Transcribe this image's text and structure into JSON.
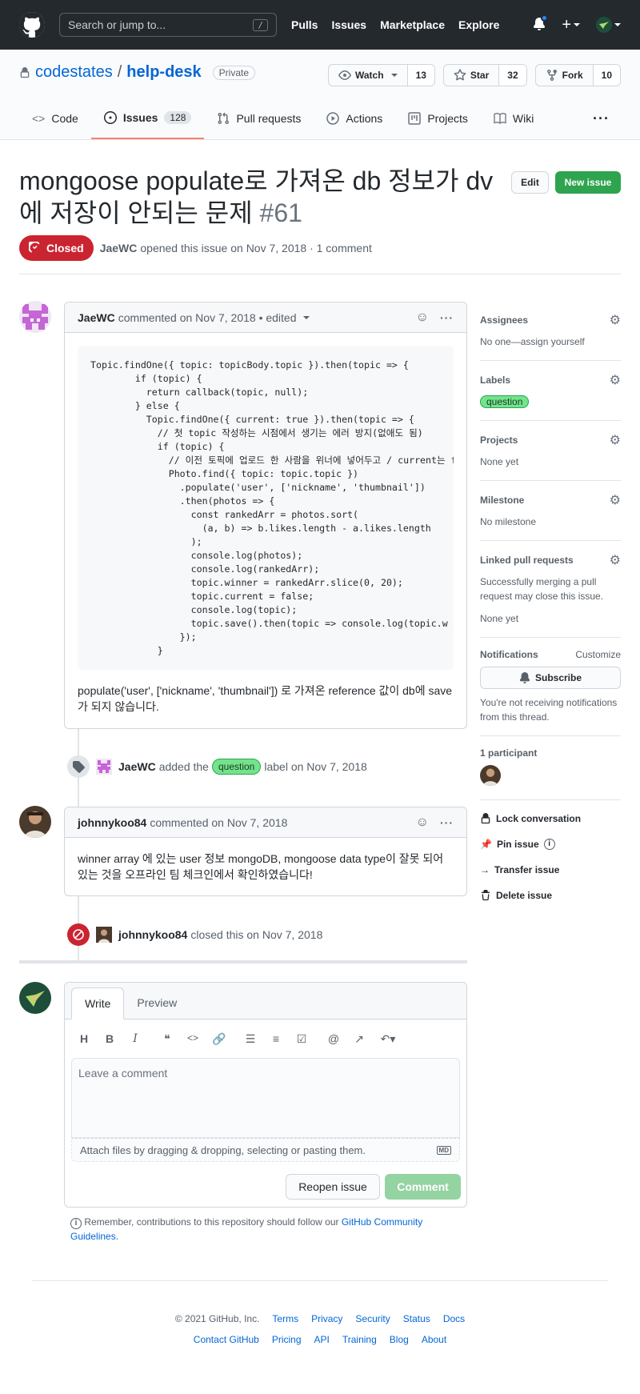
{
  "header": {
    "search_placeholder": "Search or jump to...",
    "search_shortcut": "/",
    "nav": [
      "Pulls",
      "Issues",
      "Marketplace",
      "Explore"
    ]
  },
  "repo": {
    "owner": "codestates",
    "separator": "/",
    "name": "help-desk",
    "visibility": "Private",
    "watch_label": "Watch",
    "watch_count": "13",
    "star_label": "Star",
    "star_count": "32",
    "fork_label": "Fork",
    "fork_count": "10",
    "tabs": [
      {
        "label": "Code",
        "icon": "code-icon"
      },
      {
        "label": "Issues",
        "icon": "issue-opened-icon",
        "count": "128"
      },
      {
        "label": "Pull requests",
        "icon": "git-pull-request-icon"
      },
      {
        "label": "Actions",
        "icon": "play-icon"
      },
      {
        "label": "Projects",
        "icon": "project-icon"
      },
      {
        "label": "Wiki",
        "icon": "book-icon"
      }
    ]
  },
  "issue": {
    "title": "mongoose populate로 가져온 db 정보가 dv에 저장이 안되는 문제",
    "number": "#61",
    "edit_label": "Edit",
    "new_issue_label": "New issue",
    "state": "Closed",
    "author": "JaeWC",
    "meta_text": "opened this issue on Nov 7, 2018 · 1 comment"
  },
  "comments": [
    {
      "author": "JaeWC",
      "meta": "commented on Nov 7, 2018 • edited",
      "code": "Topic.findOne({ topic: topicBody.topic }).then(topic => {\n        if (topic) {\n          return callback(topic, null);\n        } else {\n          Topic.findOne({ current: true }).then(topic => {\n            // 첫 topic 작성하는 시점에서 생기는 에러 방지(없애도 됨)\n            if (topic) {\n              // 이전 토픽에 업로드 한 사람을 위너에 넣어두고 / current는 f\n              Photo.find({ topic: topic.topic })\n                .populate('user', ['nickname', 'thumbnail'])\n                .then(photos => {\n                  const rankedArr = photos.sort(\n                    (a, b) => b.likes.length - a.likes.length\n                  );\n                  console.log(photos);\n                  console.log(rankedArr);\n                  topic.winner = rankedArr.slice(0, 20);\n                  topic.current = false;\n                  console.log(topic);\n                  topic.save().then(topic => console.log(topic.w\n                });\n            }",
      "text": "populate('user', ['nickname', 'thumbnail']) 로 가져온 reference 값이 db에 save가 되지 않습니다."
    },
    {
      "author": "johnnykoo84",
      "meta": "commented on Nov 7, 2018",
      "text": "winner array 에 있는 user 정보 mongoDB, mongoose data type이 잘못 되어있는 것을 오프라인 팀 체크인에서 확인하였습니다!"
    }
  ],
  "events": {
    "label_event": {
      "actor": "JaeWC",
      "pre": "added the",
      "label": "question",
      "post": "label on Nov 7, 2018"
    },
    "close_event": {
      "actor": "johnnykoo84",
      "text": "closed this on Nov 7, 2018"
    }
  },
  "composer": {
    "tab_write": "Write",
    "tab_preview": "Preview",
    "placeholder": "Leave a comment",
    "attach_text": "Attach files by dragging & dropping, selecting or pasting them.",
    "reopen_label": "Reopen issue",
    "comment_label": "Comment",
    "markdown_icon_text": "MD"
  },
  "remember": {
    "text": "Remember, contributions to this repository should follow our",
    "link": "GitHub Community Guidelines",
    "suffix": "."
  },
  "sidebar": {
    "assignees_title": "Assignees",
    "assignees_value": "No one—assign yourself",
    "labels_title": "Labels",
    "label_value": "question",
    "projects_title": "Projects",
    "projects_value": "None yet",
    "milestone_title": "Milestone",
    "milestone_value": "No milestone",
    "linked_title": "Linked pull requests",
    "linked_desc": "Successfully merging a pull request may close this issue.",
    "linked_value": "None yet",
    "notifications_title": "Notifications",
    "customize_label": "Customize",
    "subscribe_label": "Subscribe",
    "notifications_desc": "You're not receiving notifications from this thread.",
    "participants_title": "1 participant",
    "lock_label": "Lock conversation",
    "pin_label": "Pin issue",
    "transfer_label": "Transfer issue",
    "delete_label": "Delete issue"
  },
  "footer": {
    "copyright": "© 2021 GitHub, Inc.",
    "row1": [
      "Terms",
      "Privacy",
      "Security",
      "Status",
      "Docs"
    ],
    "row2": [
      "Contact GitHub",
      "Pricing",
      "API",
      "Training",
      "Blog",
      "About"
    ]
  },
  "colors": {
    "header_bg": "#24292e",
    "link": "#0366d6",
    "closed": "#cb2431",
    "green": "#2ea44f",
    "label_question": "#73e38c",
    "active_tab": "#f9826c"
  }
}
